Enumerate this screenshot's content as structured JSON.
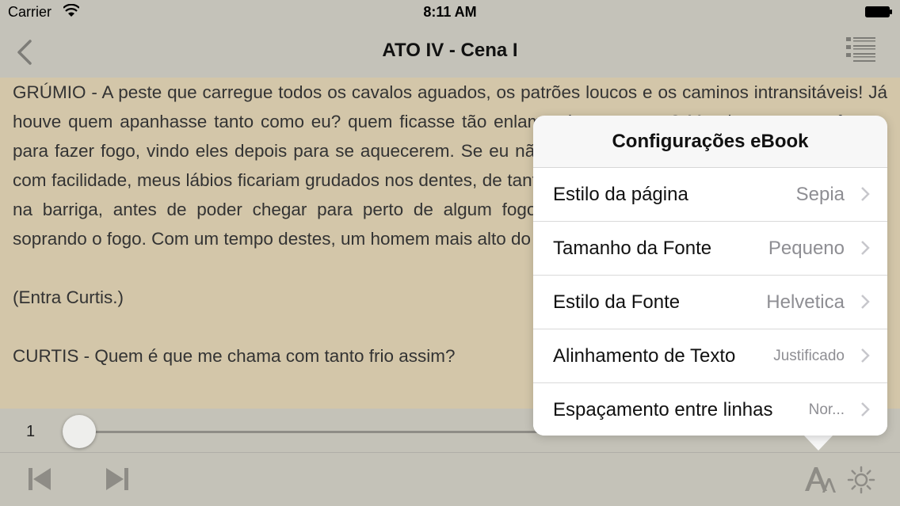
{
  "status_bar": {
    "carrier": "Carrier",
    "time": "8:11 AM"
  },
  "nav": {
    "title": "ATO IV - Cena I"
  },
  "reader": {
    "paragraphs": [
      "GRÚMIO - A peste que carregue todos os cavalos aguados, os patrões loucos e os caminos intransitáveis! Já houve quem apanhasse tanto como eu? quem ficasse tão enlameado quanto eu? Mandaram-me na frente, para fazer fogo, vindo eles depois para se aquecerem. Se eu não fosse um pote pequeno, que se esquenta com facilidade, meus lábios ficariam grudados nos dentes, de tanto frio; a língua, no céu da boca, e o coração na barriga, antes de poder chegar para perto de algum fogo e descongelar-me. Mas vou aquecer-me soprando o fogo. Com um tempo destes, um homem mais alto do que eu haveria de ficar resfriado. Olá!",
      "(Entra Curtis.)",
      "CURTIS - Quem é que me chama com tanto frio assim?"
    ]
  },
  "bottom": {
    "page_number": "1",
    "progress_fraction": 0.02
  },
  "settings": {
    "title": "Configurações eBook",
    "rows": [
      {
        "label": "Estilo da página",
        "value": "Sepia"
      },
      {
        "label": "Tamanho da Fonte",
        "value": "Pequeno"
      },
      {
        "label": "Estilo da Fonte",
        "value": "Helvetica"
      },
      {
        "label": "Alinhamento de Texto",
        "value": "Justificado"
      },
      {
        "label": "Espaçamento entre linhas",
        "value": "Nor..."
      }
    ]
  },
  "icons": {
    "back": "chevron-left-icon",
    "toc": "list-icon",
    "prev": "skip-back-icon",
    "next": "skip-forward-icon",
    "font": "font-size-icon",
    "brightness": "brightness-icon"
  },
  "colors": {
    "sepia_background": "#d3c6a9",
    "bar_background": "#c4c2b9",
    "icon_gray": "#8e8c86"
  }
}
